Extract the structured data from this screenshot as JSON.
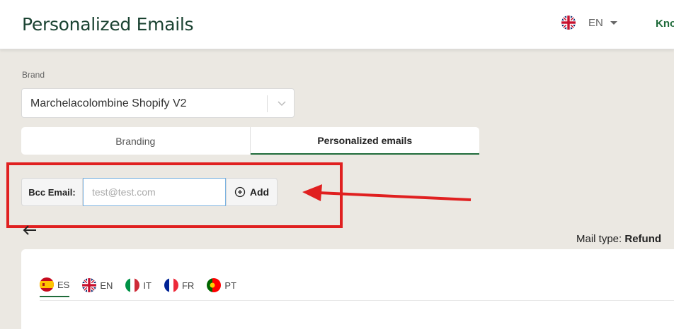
{
  "header": {
    "title": "Personalized Emails",
    "language_code": "EN",
    "user_label": "Kno"
  },
  "brand": {
    "label": "Brand",
    "selected": "Marchelacolombine Shopify V2"
  },
  "tabs": [
    {
      "label": "Branding",
      "active": false
    },
    {
      "label": "Personalized emails",
      "active": true
    }
  ],
  "bcc": {
    "label": "Bcc Email:",
    "placeholder": "test@test.com",
    "add_label": "Add"
  },
  "mail_type": {
    "prefix": "Mail type: ",
    "value": "Refund"
  },
  "language_tabs": [
    {
      "code": "ES",
      "flag": "spain-flag-icon",
      "active": true
    },
    {
      "code": "EN",
      "flag": "uk-flag-icon",
      "active": false
    },
    {
      "code": "IT",
      "flag": "italy-flag-icon",
      "active": false
    },
    {
      "code": "FR",
      "flag": "france-flag-icon",
      "active": false
    },
    {
      "code": "PT",
      "flag": "portugal-flag-icon",
      "active": false
    }
  ],
  "colors": {
    "brand_green": "#1f6b3a",
    "title_green": "#1b4332",
    "annotation_red": "#e02020",
    "background": "#ebe8e2"
  }
}
